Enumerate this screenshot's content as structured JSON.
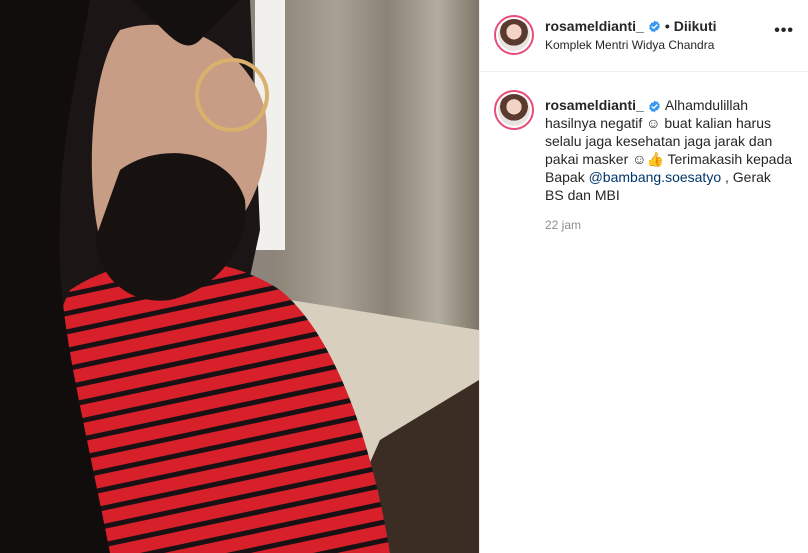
{
  "post": {
    "username": "rosameldianti_",
    "separator": "•",
    "follow_status": "Diikuti",
    "location": "Komplek Mentri Widya Chandra",
    "more_label": "•••",
    "caption": {
      "username": "rosameldianti_",
      "text_before_mention": "Alhamdulillah hasilnya negatif ☺ buat kalian harus selalu jaga kesehatan jaga jarak dan pakai masker ☺👍 Terimakasih kepada Bapak ",
      "mention": "@bambang.soesatyo",
      "text_after_mention": " , Gerak BS dan MBI"
    },
    "timestamp": "22 jam"
  },
  "colors": {
    "verified_badge": "#3897f0",
    "story_ring": "#e94b79",
    "mention": "#00376b",
    "secondary_text": "#8e8e8e"
  },
  "icons": {
    "verified": "verified-badge-icon",
    "more": "more-options-icon"
  }
}
